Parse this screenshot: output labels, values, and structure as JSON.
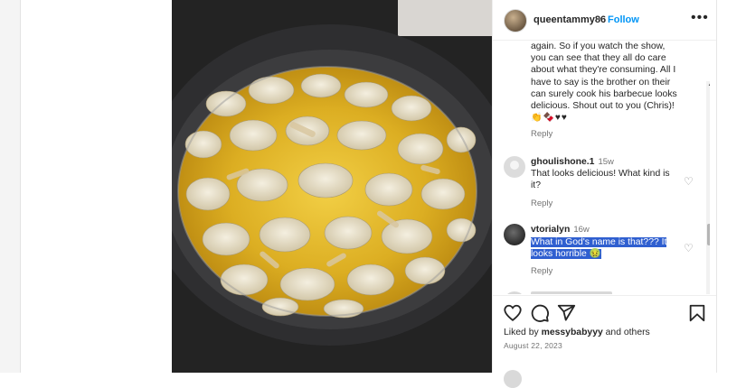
{
  "post": {
    "username": "queentammy86",
    "separator": "•",
    "follow_label": "Follow",
    "more_icon": "more-horizontal-icon"
  },
  "caption": {
    "text": "again. So if you watch the show, you can see that they all do care about what they're consuming. All I have to say is the brother on their can surely cook his barbecue looks delicious. Shout out to you (Chris)!",
    "emojis": "👏🍫♥♥",
    "reply_label": "Reply"
  },
  "comments": [
    {
      "username": "ghoulishone.1",
      "time": "15w",
      "text": "That looks delicious! What kind is it?",
      "reply_label": "Reply"
    },
    {
      "username": "vtorialyn",
      "time": "16w",
      "text": "What in God's name is that??? It looks horrible 🤢",
      "reply_label": "Reply"
    }
  ],
  "likes": {
    "prefix": "Liked by ",
    "user": "messybabyyy",
    "suffix": " and others"
  },
  "date": "August 22, 2023",
  "colors": {
    "accent": "#0095f6",
    "selection": "#2f5fd0",
    "muted": "#737373"
  },
  "icons": [
    "heart-icon",
    "comment-icon",
    "share-icon",
    "bookmark-icon",
    "chevron-right-icon"
  ]
}
